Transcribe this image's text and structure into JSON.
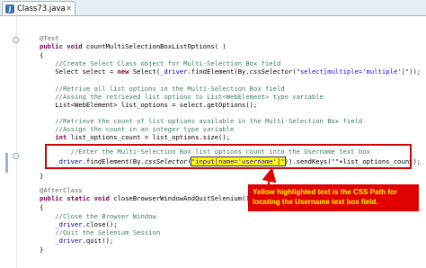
{
  "editor": {
    "tab_label": "Class73.java",
    "tab_icon_letter": "J",
    "tab_close": "✕"
  },
  "code": {
    "l1": "@Test",
    "l2_kw": "public void",
    "l2_rest": " countMultiSelectionBoxListOptions( )",
    "l3": "{",
    "l4": "    //Create Select Class object for Multi-Selection Box field",
    "l5_a": "    Select select = ",
    "l5_kw": "new",
    "l5_b": " Select(",
    "l5_fd": "_driver",
    "l5_c": ".findElement(By.",
    "l5_it": "cssSelector",
    "l5_d": "(",
    "l5_st": "\"select[multiple='multiple']\"",
    "l5_e": "));",
    "l6": "    //Retrive all list options in the Multi-Selection Box field",
    "l7": "    //Assing the retrieved list options to List<WebElement> type variable",
    "l8": "    List<WebElement> list_options = select.getOptions();",
    "l9": "    //Retrieve the count of list options available in the Multi-Selection Box field",
    "l10": "    //Assign the count in an integer type variable",
    "l11_kw": "int",
    "l11_rest": " list_options_count = list_options.size();",
    "l12": "    //Enter the Multi-Selection Box list options count into the Username text box",
    "l13_fd": "_driver",
    "l13_a": ".findElement(By.",
    "l13_it": "cssSelector",
    "l13_b": "(",
    "l13_st": "\"input[name='username']\"",
    "l13_c": ")).sendKeys(",
    "l13_st2": "\"\"",
    "l13_d": "+list_options_count);",
    "l14": "}",
    "l15": "@AfterClass",
    "l16_kw": "public static void",
    "l16_rest": " closeBrowserWindowAndQuitSelenium()",
    "l17": "{",
    "l18": "    //Close the Browser Window",
    "l19_fd": "_driver",
    "l19_rest": ".close();",
    "l20": "    //Quit the Selenium Session",
    "l21_fd": "_driver",
    "l21_rest": ".quit();",
    "l22": "}"
  },
  "callout": {
    "text": "Yellow highlighted text is the CSS Path for locating the Username text box field."
  },
  "colors": {
    "annotation_red": "#e00000",
    "callout_text": "#ffff00",
    "highlight": "#ffff00"
  }
}
